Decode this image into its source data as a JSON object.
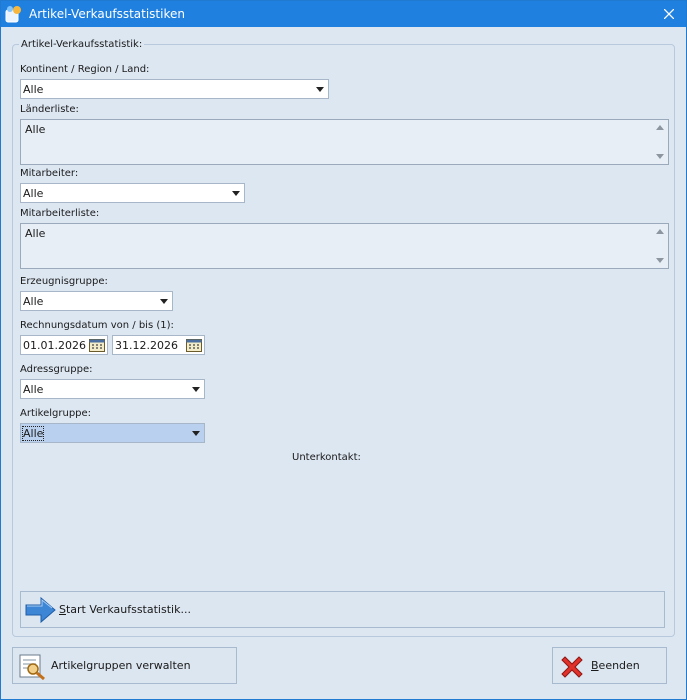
{
  "window": {
    "title": "Artikel-Verkaufsstatistiken"
  },
  "group": {
    "legend": "Artikel-Verkaufsstatistik:"
  },
  "fields": {
    "region": {
      "label": "Kontinent / Region / Land:",
      "value": "Alle"
    },
    "country_list": {
      "label": "Länderliste:",
      "items": [
        "Alle"
      ]
    },
    "employee": {
      "label": "Mitarbeiter:",
      "value": "Alle"
    },
    "employee_list": {
      "label": "Mitarbeiterliste:",
      "items": [
        "Alle"
      ]
    },
    "product_group": {
      "label": "Erzeugnisgruppe:",
      "value": "Alle"
    },
    "invoice_date": {
      "label": "Rechnungsdatum von / bis (1):",
      "from": "01.01.2026",
      "to": "31.12.2026"
    },
    "address_group": {
      "label": "Adressgruppe:",
      "value": "Alle"
    },
    "article_group": {
      "label": "Artikelgruppe:",
      "value": "Alle"
    },
    "subcontact": {
      "label": "Unterkontakt:"
    }
  },
  "buttons": {
    "start": {
      "mnemonic": "S",
      "rest": "tart Verkaufsstatistik..."
    },
    "manage": {
      "label": "Artikelgruppen verwalten"
    },
    "exit": {
      "mnemonic": "B",
      "rest": "eenden"
    }
  },
  "colors": {
    "titlebar": "#1f80e0",
    "client": "#dde7f2",
    "selection": "#b9d1ef"
  }
}
